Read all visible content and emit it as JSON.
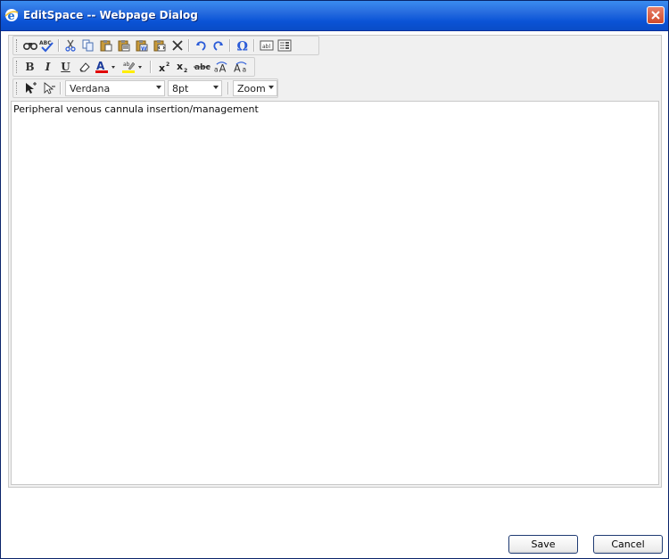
{
  "window": {
    "title": "EditSpace -- Webpage Dialog"
  },
  "toolbar": {
    "font_name": "Verdana",
    "font_size": "8pt",
    "zoom": "Zoom",
    "bold": "B",
    "italic": "I",
    "underline": "U"
  },
  "editor": {
    "content": "Peripheral venous cannula insertion/management"
  },
  "buttons": {
    "save": "Save",
    "cancel": "Cancel"
  },
  "colors": {
    "titlebar": "#0a53d6",
    "font_color_bar": "#e00000",
    "highlight_bar": "#ffee00",
    "undo_redo": "#2a5bd8"
  }
}
